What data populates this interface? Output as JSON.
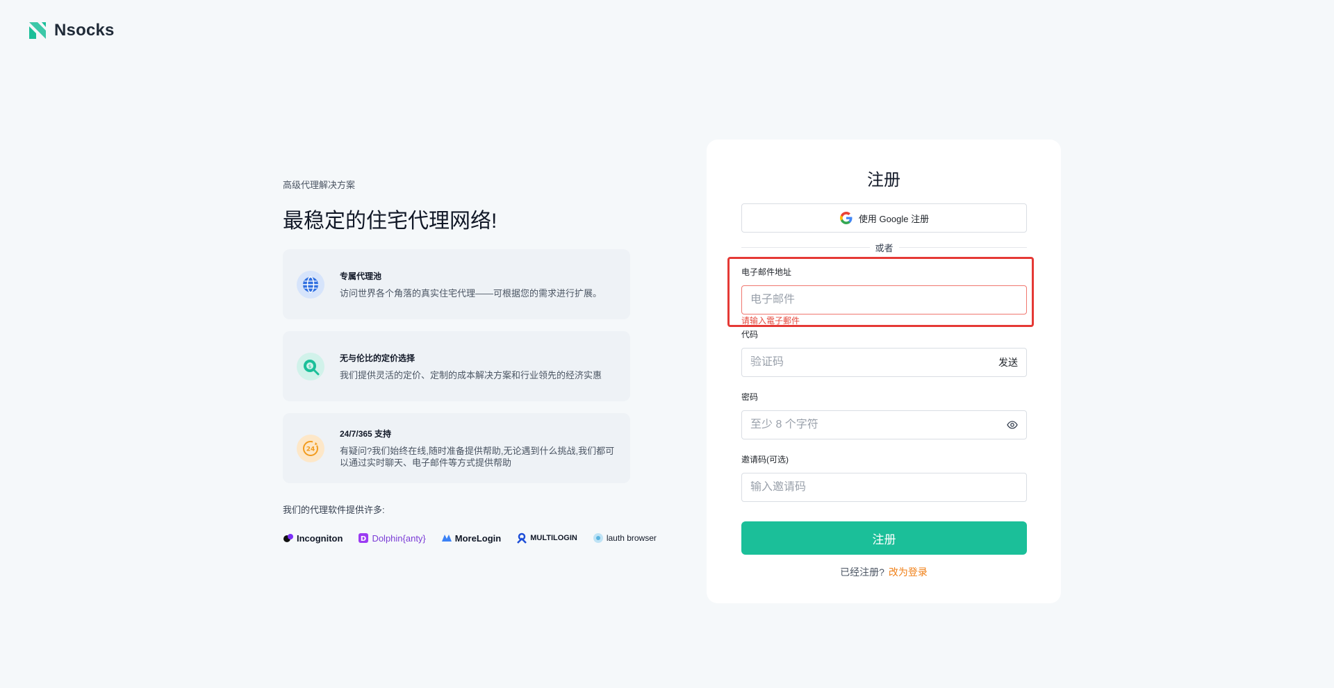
{
  "brand": {
    "name": "Nsocks",
    "accent": "#1bbf99"
  },
  "left": {
    "eyebrow": "高级代理解决方案",
    "headline": "最稳定的住宅代理网络!",
    "features": [
      {
        "icon": "globe-icon",
        "title": "专属代理池",
        "desc": "访问世界各个角落的真实住宅代理——可根据您的需求进行扩展。"
      },
      {
        "icon": "price-search-icon",
        "title": "无与伦比的定价选择",
        "desc": "我们提供灵活的定价、定制的成本解决方案和行业领先的经济实惠"
      },
      {
        "icon": "24h-support-icon",
        "title": "24/7/365 支持",
        "desc": "有疑问?我们始终在线,随时准备提供帮助,无论遇到什么挑战,我们都可以通过实时聊天、电子邮件等方式提供帮助"
      }
    ],
    "support_text": "我们的代理软件提供许多:",
    "partners": [
      "Incogniton",
      "Dolphin{anty}",
      "MoreLogin",
      "MULTILOGIN",
      "lauth browser"
    ]
  },
  "form": {
    "title": "注册",
    "google_button": "使用 Google 注册",
    "or_text": "或者",
    "email_label": "电子邮件地址",
    "email_placeholder": "电子邮件",
    "email_error": "请输入電子郵件",
    "code_label": "代码",
    "code_placeholder": "验证码",
    "send_label": "发送",
    "password_label": "密码",
    "password_placeholder": "至少 8 个字符",
    "invite_label": "邀请码(可选)",
    "invite_placeholder": "输入邀请码",
    "submit_label": "注册",
    "login_prompt": "已经注册?",
    "login_link": "改为登录"
  }
}
